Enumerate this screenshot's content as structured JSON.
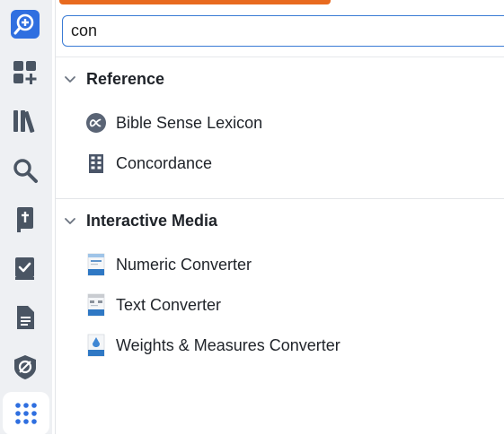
{
  "search": {
    "value": "con"
  },
  "rail": {
    "items": [
      {
        "icon": "search-plus-icon",
        "active": false
      },
      {
        "icon": "dashboard-add-icon",
        "active": false
      },
      {
        "icon": "library-icon",
        "active": false
      },
      {
        "icon": "search-icon",
        "active": false
      },
      {
        "icon": "bible-icon",
        "active": false
      },
      {
        "icon": "checklist-book-icon",
        "active": false
      },
      {
        "icon": "document-icon",
        "active": false
      },
      {
        "icon": "atlas-icon",
        "active": false
      },
      {
        "icon": "apps-grid-icon",
        "active": true
      }
    ]
  },
  "sections": [
    {
      "title": "Reference",
      "items": [
        {
          "label": "Bible Sense Lexicon",
          "icon": "lexicon-icon"
        },
        {
          "label": "Concordance",
          "icon": "concordance-icon"
        }
      ]
    },
    {
      "title": "Interactive Media",
      "items": [
        {
          "label": "Numeric Converter",
          "icon": "numeric-converter-icon"
        },
        {
          "label": "Text Converter",
          "icon": "text-converter-icon"
        },
        {
          "label": "Weights & Measures Converter",
          "icon": "weights-measures-icon"
        }
      ]
    }
  ],
  "colors": {
    "accent": "#e86a1f",
    "focus": "#3a7bd5",
    "active_rail_icon": "#2f6fe0",
    "rail_icon": "#4a5563"
  }
}
